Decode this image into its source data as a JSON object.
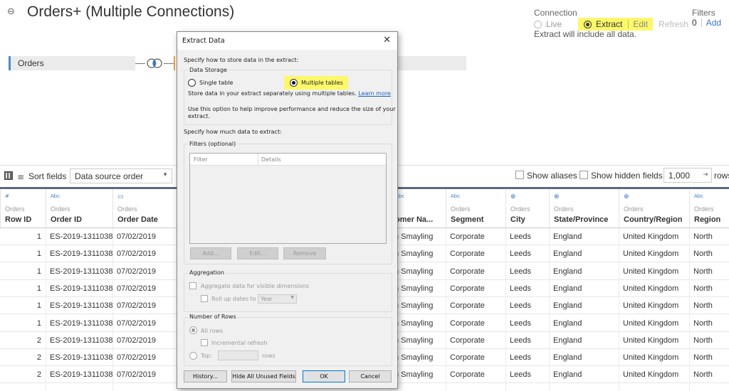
{
  "header": {
    "title": "Orders+ (Multiple Connections)",
    "connection_label": "Connection",
    "live_label": "Live",
    "extract_label": "Extract",
    "edit_label": "Edit",
    "refresh_label": "Refresh",
    "extract_note": "Extract will include all data.",
    "filters_label": "Filters",
    "filters_count": "0",
    "filters_add": "Add"
  },
  "canvas": {
    "table_name": "Orders"
  },
  "toolbar": {
    "sort_label": "Sort fields",
    "sort_value": "Data source order",
    "show_aliases": "Show aliases",
    "show_hidden": "Show hidden fields",
    "rows_value": "1,000",
    "rows_label": "rows"
  },
  "grid": {
    "columns": [
      {
        "type": "#",
        "source": "Orders",
        "name": "Row ID"
      },
      {
        "type": "Abc",
        "source": "Orders",
        "name": "Order ID"
      },
      {
        "type": "date",
        "source": "Orders",
        "name": "Order Date"
      },
      {
        "type": "Abc",
        "source": "",
        "name": "omer Na..."
      },
      {
        "type": "Abc",
        "source": "Orders",
        "name": "Segment"
      },
      {
        "type": "globe",
        "source": "Orders",
        "name": "City"
      },
      {
        "type": "globe",
        "source": "Orders",
        "name": "State/Province"
      },
      {
        "type": "globe",
        "source": "Orders",
        "name": "Country/Region"
      },
      {
        "type": "Abc",
        "source": "Orders",
        "name": "Region"
      }
    ],
    "rows": [
      [
        "1",
        "ES-2019-1311038",
        "07/02/2019",
        "n Smayling",
        "Corporate",
        "Leeds",
        "England",
        "United Kingdom",
        "North"
      ],
      [
        "1",
        "ES-2019-1311038",
        "07/02/2019",
        "n Smayling",
        "Corporate",
        "Leeds",
        "England",
        "United Kingdom",
        "North"
      ],
      [
        "1",
        "ES-2019-1311038",
        "07/02/2019",
        "n Smayling",
        "Corporate",
        "Leeds",
        "England",
        "United Kingdom",
        "North"
      ],
      [
        "1",
        "ES-2019-1311038",
        "07/02/2019",
        "n Smayling",
        "Corporate",
        "Leeds",
        "England",
        "United Kingdom",
        "North"
      ],
      [
        "1",
        "ES-2019-1311038",
        "07/02/2019",
        "n Smayling",
        "Corporate",
        "Leeds",
        "England",
        "United Kingdom",
        "North"
      ],
      [
        "1",
        "ES-2019-1311038",
        "07/02/2019",
        "n Smayling",
        "Corporate",
        "Leeds",
        "England",
        "United Kingdom",
        "North"
      ],
      [
        "2",
        "ES-2019-1311038",
        "07/02/2019",
        "n Smayling",
        "Corporate",
        "Leeds",
        "England",
        "United Kingdom",
        "North"
      ],
      [
        "2",
        "ES-2019-1311038",
        "07/02/2019",
        "n Smayling",
        "Corporate",
        "Leeds",
        "England",
        "United Kingdom",
        "North"
      ],
      [
        "2",
        "ES-2019-1311038",
        "07/02/2019",
        "n Smayling",
        "Corporate",
        "Leeds",
        "England",
        "United Kingdom",
        "North"
      ]
    ]
  },
  "dialog": {
    "title": "Extract Data",
    "close": "✕",
    "store_prompt": "Specify how to store data in the extract:",
    "storage_group": "Data Storage",
    "single_table": "Single table",
    "multiple_tables": "Multiple tables",
    "storage_desc": "Store data in your extract separately using multiple tables.",
    "learn_more": "Learn more",
    "perf_line1": "Use this option to help improve performance and reduce the size of your",
    "perf_line2": "extract.",
    "amount_prompt": "Specify how much data to extract:",
    "filters_group": "Filters (optional)",
    "col_filter": "Filter",
    "col_details": "Details",
    "btn_add": "Add...",
    "btn_edit": "Edit...",
    "btn_remove": "Remove",
    "aggregation_group": "Aggregation",
    "aggregate_label": "Aggregate data for visible dimensions",
    "rollup_label": "Roll up dates to",
    "rollup_value": "Year",
    "rows_group": "Number of Rows",
    "all_rows": "All rows",
    "incremental": "Incremental refresh",
    "top_label": "Top:",
    "rows_unit": "rows",
    "btn_history": "History...",
    "btn_hide_unused": "Hide All Unused Fields",
    "btn_ok": "OK",
    "btn_cancel": "Cancel"
  },
  "colors": {
    "highlight": "#fdf86a",
    "accent_blue": "#3b78c2",
    "canvas_bar_edge": "#4b8cc9"
  }
}
